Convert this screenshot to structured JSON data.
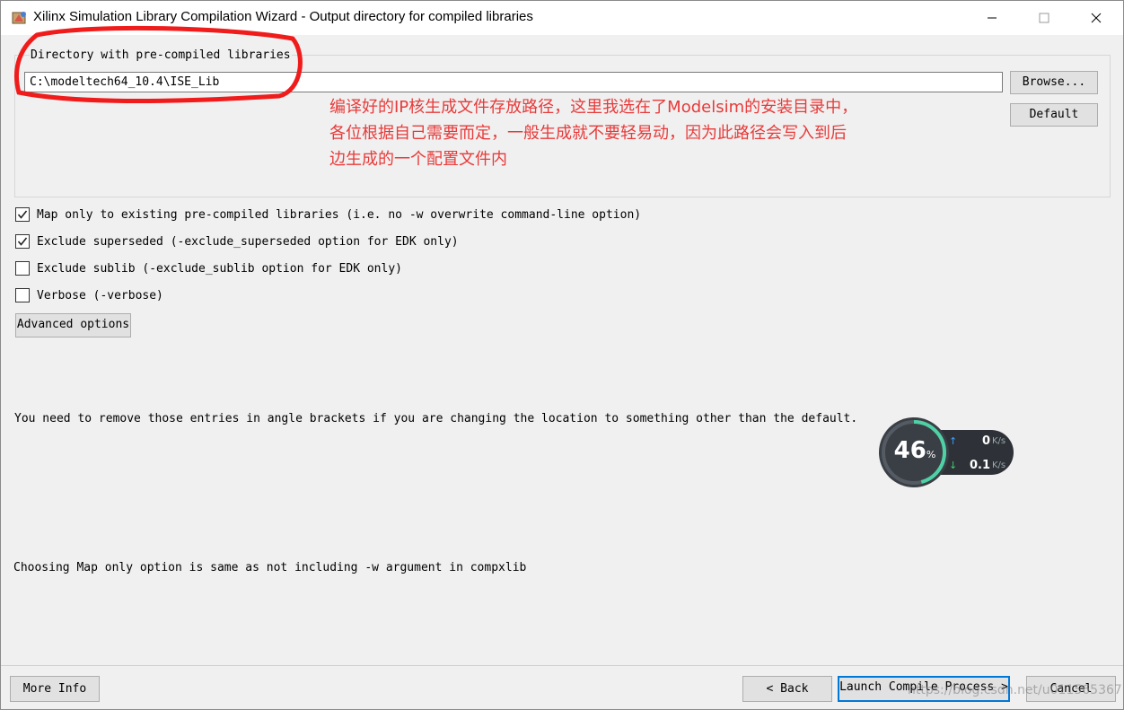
{
  "window": {
    "title": "Xilinx Simulation Library Compilation Wizard - Output directory for compiled libraries"
  },
  "directory": {
    "label": "Directory with pre-compiled libraries",
    "value": "C:\\modeltech64_10.4\\ISE_Lib",
    "browse_label": "Browse...",
    "default_label": "Default"
  },
  "annotation": {
    "lines": [
      "编译好的IP核生成文件存放路径，这里我选在了Modelsim的安装目录中，",
      "各位根据自己需要而定，一般生成就不要轻易动，因为此路径会写入到后",
      "边生成的一个配置文件内"
    ],
    "color": "#e83a3a"
  },
  "options": [
    {
      "label": "Map only to existing pre-compiled libraries (i.e. no -w overwrite command-line option)",
      "checked": true
    },
    {
      "label": "Exclude superseded (-exclude_superseded option for EDK only)",
      "checked": true
    },
    {
      "label": "Exclude sublib (-exclude_sublib option for EDK only)",
      "checked": false
    },
    {
      "label": "Verbose (-verbose)",
      "checked": false
    }
  ],
  "advanced_label": "Advanced options",
  "info": {
    "angle_brackets": "You need to remove those entries in angle brackets if you are changing the location to something other than the default.",
    "map_only": "Choosing Map only option is same as not including -w argument in compxlib"
  },
  "net_widget": {
    "percent": "46",
    "percent_unit": "%",
    "upload_value": "0",
    "upload_unit": "K/s",
    "download_value": "0.1",
    "download_unit": "K/s"
  },
  "footer": {
    "more_info": "More Info",
    "back": "< Back",
    "launch": "Launch Compile Process >",
    "cancel": "Cancel"
  },
  "watermark": "https://blog.csdn.net/u011565367"
}
